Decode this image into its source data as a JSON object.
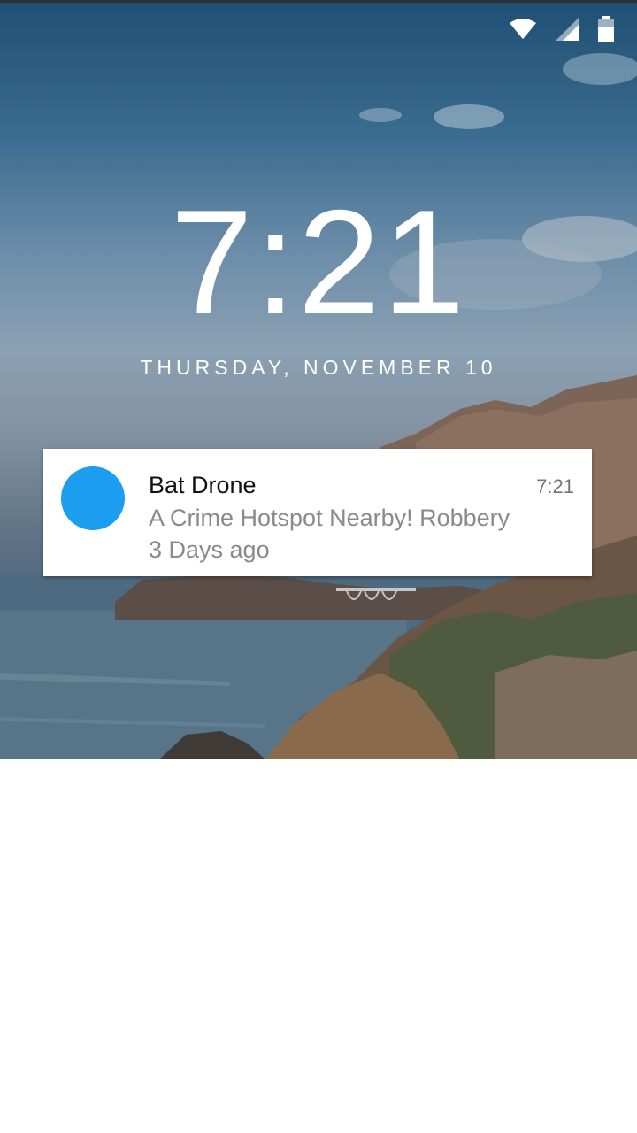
{
  "status_bar": {
    "icons": [
      "wifi-icon",
      "cellular-signal-icon",
      "battery-icon"
    ],
    "color": "#ffffff"
  },
  "lockscreen": {
    "time": "7:21",
    "date": "THURSDAY, NOVEMBER 10"
  },
  "notification": {
    "app_name": "Bat Drone",
    "time": "7:21",
    "message": "A Crime Hotspot Nearby! Robbery",
    "subtext": "3 Days ago",
    "avatar_color": "#1b9df0"
  }
}
